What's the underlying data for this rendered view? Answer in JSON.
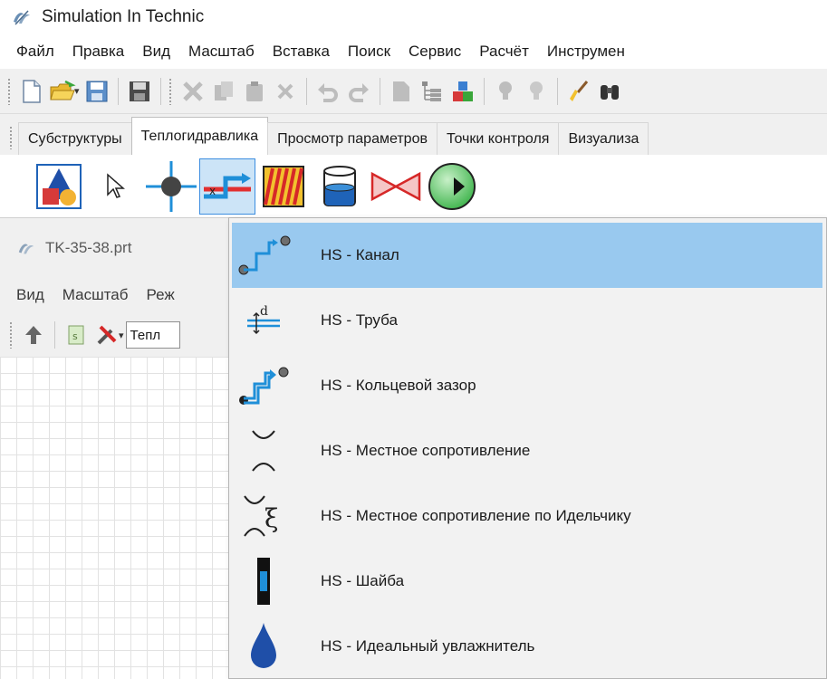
{
  "app": {
    "title": "Simulation In Technic"
  },
  "menu": [
    "Файл",
    "Правка",
    "Вид",
    "Масштаб",
    "Вставка",
    "Поиск",
    "Сервис",
    "Расчёт",
    "Инструмен"
  ],
  "tabs": [
    "Субструктуры",
    "Теплогидравлика",
    "Просмотр параметров",
    "Точки контроля",
    "Визуализа"
  ],
  "active_tab": "Теплогидравлика",
  "palette_icons": [
    "shapes-icon",
    "pointer-icon",
    "node-icon",
    "channel-icon",
    "heat-exchange-icon",
    "tank-icon",
    "valve-icon",
    "pump-icon"
  ],
  "selected_palette_icon": "channel-icon",
  "document": {
    "title": "TK-35-38.prt",
    "menu": [
      "Вид",
      "Масштаб",
      "Реж"
    ],
    "combo_value": "Тепл"
  },
  "dropdown": {
    "items": [
      {
        "label": "HS - Канал",
        "icon": "channel-icon",
        "highlighted": true
      },
      {
        "label": "HS - Труба",
        "icon": "pipe-icon"
      },
      {
        "label": "HS - Кольцевой зазор",
        "icon": "annular-gap-icon"
      },
      {
        "label": "HS - Местное сопротивление",
        "icon": "local-resistance-icon"
      },
      {
        "label": "HS - Местное сопротивление по Идельчику",
        "icon": "idelchik-resistance-icon"
      },
      {
        "label": "HS - Шайба",
        "icon": "orifice-icon"
      },
      {
        "label": "HS - Идеальный увлажнитель",
        "icon": "humidifier-icon"
      }
    ]
  },
  "colors": {
    "highlight": "#99c9ef",
    "palette_selected": "#cce4f7",
    "accent_blue": "#1f8fd8"
  }
}
